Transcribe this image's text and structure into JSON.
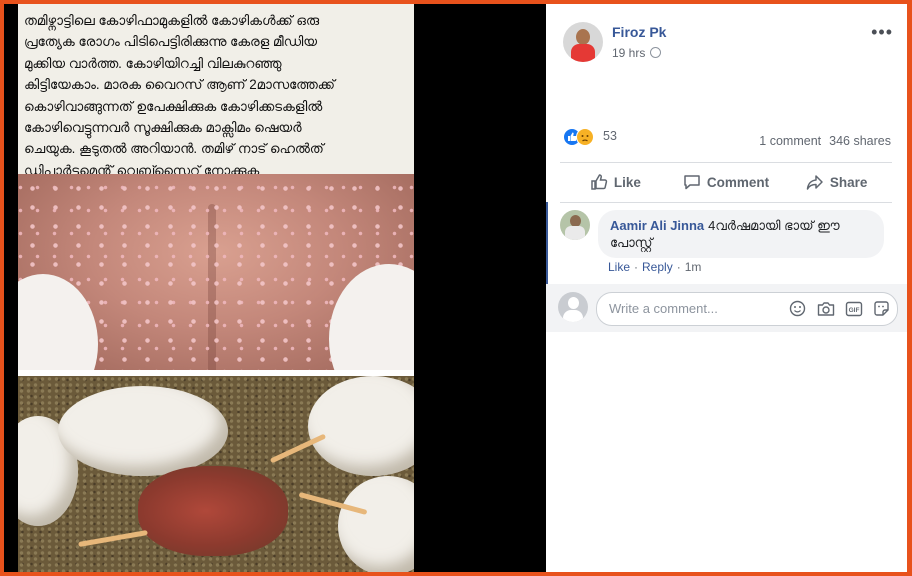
{
  "post": {
    "caption": "തമിഴ്നാട്ടിലെ കോഴിഫാമുകളിൽ കോഴികൾക്ക് ഒരു\nപ്രത്യേക  രോഗം പിടിപെട്ടിരിക്കുന്നു  കേരള മീഡിയ\nമുക്കിയ വാർത്ത. കോഴിയിറച്ചി വിലകുറഞ്ഞു\nകിട്ടിയേകാം. മാരക വൈറസ് ആണ് 2മാസത്തേക്ക്\nകൊഴിവാങ്ങുന്നത് ഉപേക്ഷിക്കുക കോഴിക്കടകളിൽ\nകോഴിവെട്ടുന്നവർ സൂക്ഷിക്കുക മാക്സിമം ഷെയർ\nചെയുക. കൂടുതൽ അറിയാൻ. തമിഴ് നാട്   ഹെൽത്\nഡിപ്പാർട്ടമെന്റ് വെബ്സൈറ്റ് നോക്കുക"
  },
  "header": {
    "poster_name": "Firoz Pk",
    "time": "19 hrs",
    "more": "•••"
  },
  "stats": {
    "reaction_count": "53",
    "comments": "1 comment",
    "shares": "346 shares"
  },
  "actions": {
    "like": "Like",
    "comment": "Comment",
    "share": "Share"
  },
  "comment": {
    "author": "Aamir Ali Jinna",
    "text": "4വർഷമായി ഭായ് ഈ പോസ്റ്റ്",
    "like": "Like",
    "reply": "Reply",
    "age": "1m"
  },
  "write": {
    "placeholder": "Write a comment..."
  },
  "colors": {
    "border": "#e8521c",
    "link": "#385898",
    "like_blue": "#1877f2",
    "sad_yellow": "#f7b125"
  },
  "icons": [
    "globe-icon",
    "like-reaction-icon",
    "sad-reaction-icon",
    "thumbs-up-icon",
    "comment-icon",
    "share-icon",
    "emoji-icon",
    "camera-icon",
    "gif-icon",
    "sticker-icon"
  ]
}
